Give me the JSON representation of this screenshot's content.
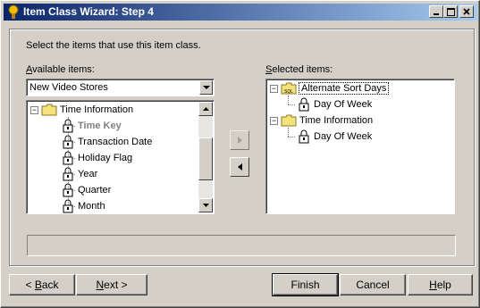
{
  "window": {
    "title": "Item Class Wizard: Step 4",
    "minimize_label": "_",
    "maximize_label": "□",
    "close_label": "×"
  },
  "instructions": "Select the items that use this item class.",
  "available": {
    "label_prefix": "",
    "label_underlined": "A",
    "label_rest": "vailable items:",
    "dropdown_value": "New Video Stores",
    "tree": {
      "root": "Time Information",
      "items": [
        "Time Key",
        "Transaction Date",
        "Holiday Flag",
        "Year",
        "Quarter",
        "Month"
      ]
    }
  },
  "selected": {
    "label_underlined": "S",
    "label_rest": "elected items:",
    "tree": [
      {
        "label": "Alternate Sort Days",
        "children": [
          "Day Of Week"
        ]
      },
      {
        "label": "Time Information",
        "children": [
          "Day Of Week"
        ]
      }
    ]
  },
  "buttons": {
    "back_u": "B",
    "back_rest": "ack",
    "back_prefix": "< ",
    "next_u": "N",
    "next_rest": "ext >",
    "finish": "Finish",
    "cancel": "Cancel",
    "help_u": "H",
    "help_rest": "elp"
  },
  "colors": {
    "titlebar_start": "#0a246a",
    "titlebar_end": "#a6caf0",
    "face": "#d4d0c8"
  }
}
